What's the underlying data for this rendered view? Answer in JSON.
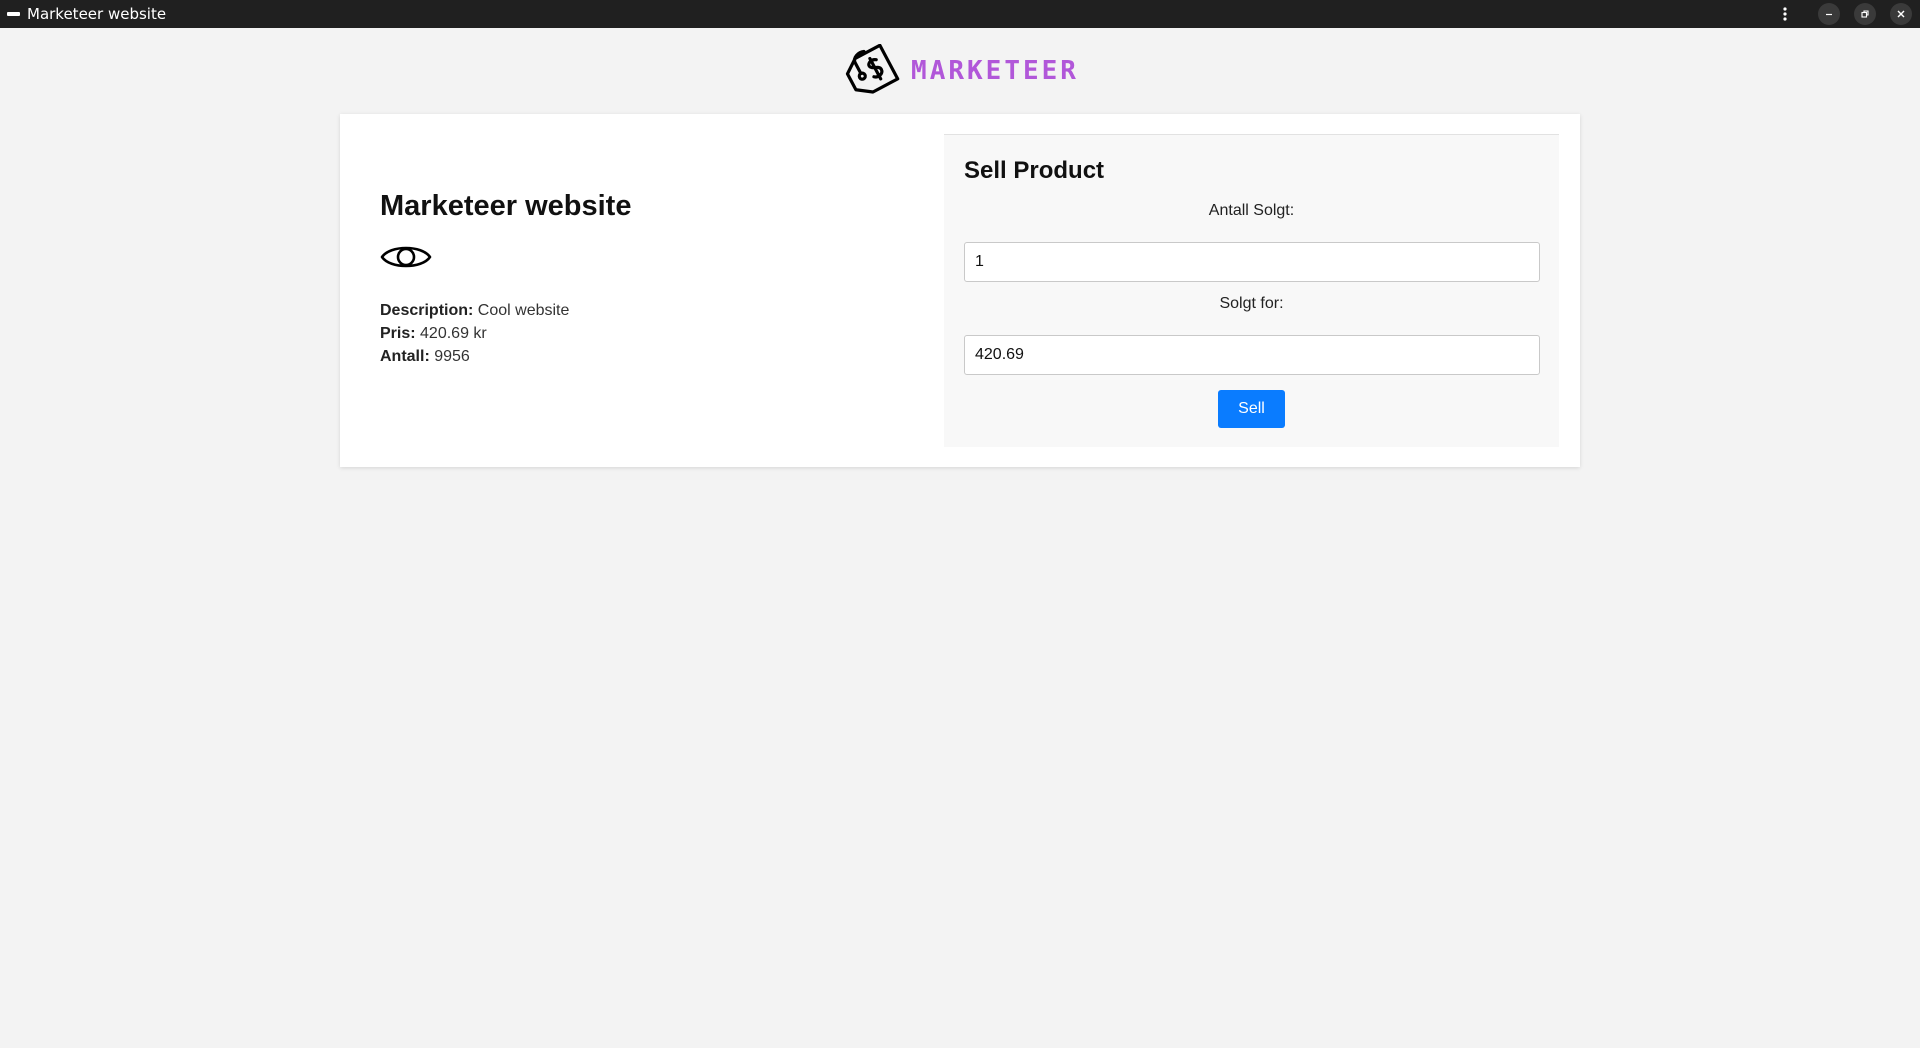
{
  "window": {
    "title": "Marketeer website"
  },
  "header": {
    "brand": "MARKETEER",
    "logo_icon": "price-tag-icon",
    "brand_color": "#b157d9"
  },
  "product": {
    "title": "Marketeer website",
    "view_icon": "eye-icon",
    "description_label": "Description:",
    "description_value": "Cool website",
    "price_label": "Pris:",
    "price_value": "420.69 kr",
    "quantity_label": "Antall:",
    "quantity_value": "9956"
  },
  "sell_form": {
    "title": "Sell Product",
    "quantity_label": "Antall Solgt:",
    "quantity_value": "1",
    "price_label": "Solgt for:",
    "price_value": "420.69",
    "submit_label": "Sell",
    "submit_color": "#0a7cff"
  }
}
